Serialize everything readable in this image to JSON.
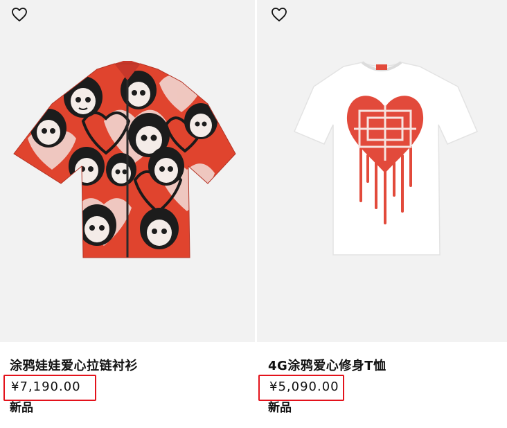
{
  "products": [
    {
      "name": "涂鸦娃娃爱心拉链衬衫",
      "price": "¥7,190.00",
      "badge": "新品",
      "wishlist_icon": "heart-outline-icon"
    },
    {
      "name": "4G涂鸦爱心修身T恤",
      "price": "¥5,090.00",
      "badge": "新品",
      "wishlist_icon": "heart-outline-icon"
    }
  ],
  "colors": {
    "image_background": "#f2f2f2",
    "highlight": "#e3121b",
    "shirt_red": "#e0442e",
    "heart_print_red": "#e24a3b",
    "text": "#111111"
  }
}
